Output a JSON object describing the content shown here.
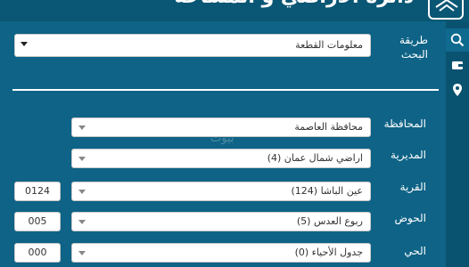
{
  "header": {
    "title": "دائرة الأراضي و المساحة"
  },
  "search": {
    "method_label": "طريقة البحث",
    "method_value": "معلومات القطعة"
  },
  "form": {
    "governorate_label": "المحافظة",
    "governorate_value": "محافظة العاصمة",
    "directorate_label": "المديرية",
    "directorate_value": "اراضي شمال عمان (4)",
    "village_label": "القرية",
    "village_value": "عين الباشا (124)",
    "village_code": "0124",
    "basin_label": "الحوض",
    "basin_value": "ربوع العدس (5)",
    "basin_code": "005",
    "district_label": "الحي",
    "district_value": "جدول الأحياء (0)",
    "district_code": "000"
  },
  "sidebar": {
    "icons": [
      "search-icon",
      "wallet-icon",
      "location-pin-icon"
    ]
  },
  "colors": {
    "background": "#0e6386",
    "header": "#0a5675",
    "sidebar": "#0a5370"
  }
}
